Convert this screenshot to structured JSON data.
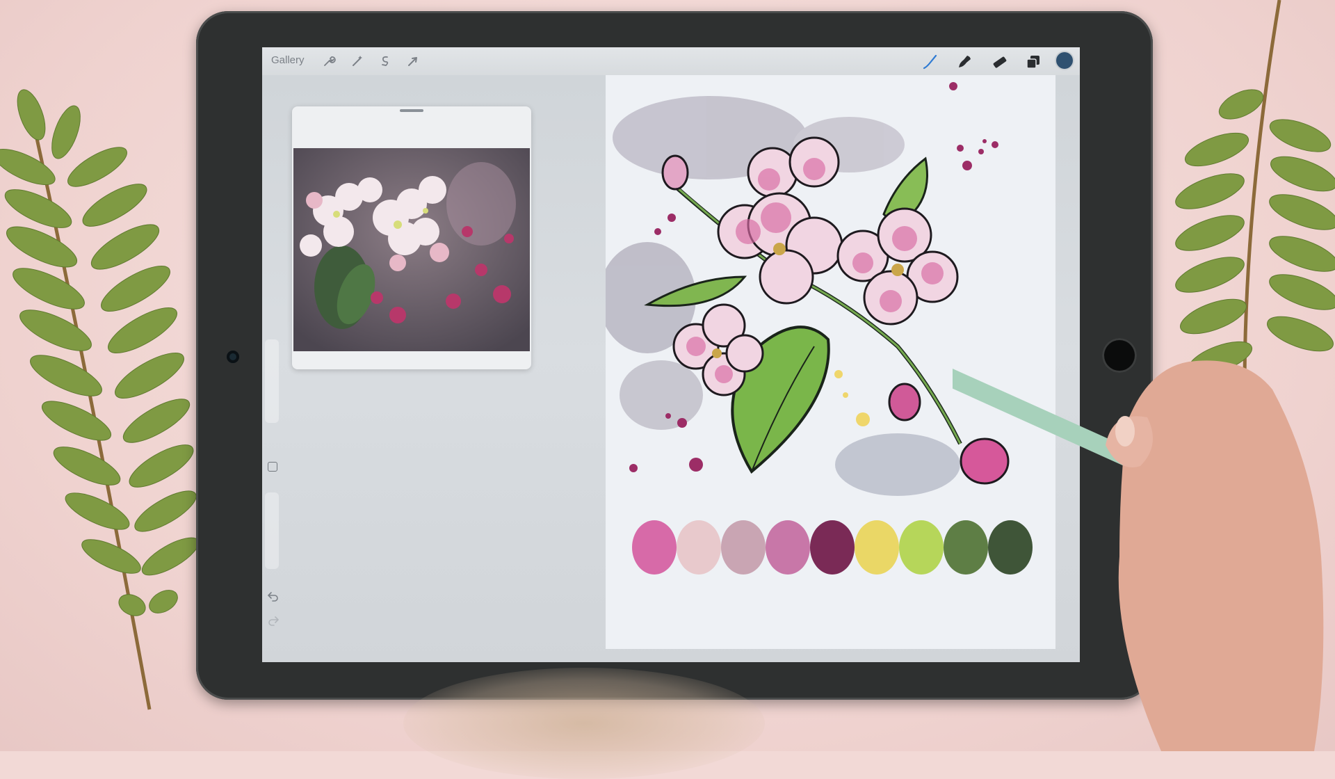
{
  "toolbar": {
    "gallery_label": "Gallery",
    "left_icons": [
      "wrench-icon",
      "magic-wand-icon",
      "selection-icon",
      "transform-arrow-icon"
    ],
    "right_icons": [
      "brush-icon",
      "smudge-icon",
      "eraser-icon",
      "layers-icon"
    ],
    "current_color": "#2f5170"
  },
  "colors": {
    "screen_bg": "#d7dbde",
    "canvas_bg": "#eef1f5",
    "bezel": "#2e3030",
    "desk": "#f2d9d6"
  },
  "palette": {
    "swatches": [
      "#d76aa8",
      "#e8c9cc",
      "#c9a5b3",
      "#c877a8",
      "#7a2a56",
      "#ead766",
      "#b6d65a",
      "#5e7e45",
      "#3f5538"
    ]
  }
}
